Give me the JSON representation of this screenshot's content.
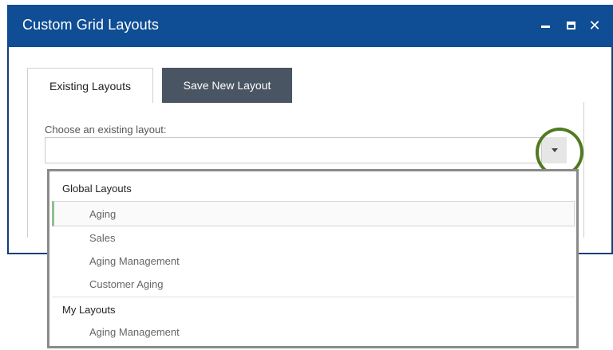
{
  "window": {
    "title": "Custom Grid Layouts",
    "controls": {
      "minimize": "–",
      "maximize": "□",
      "close": "✕"
    }
  },
  "tabs": [
    {
      "label": "Existing Layouts",
      "active": true
    },
    {
      "label": "Save New Layout",
      "active": false
    }
  ],
  "form": {
    "label": "Choose an existing layout:",
    "value": ""
  },
  "dropdown": {
    "groups": [
      {
        "label": "Global Layouts",
        "items": [
          "Aging",
          "Sales",
          "Aging Management",
          "Customer Aging"
        ]
      },
      {
        "label": "My Layouts",
        "items": [
          "Aging Management"
        ]
      }
    ],
    "highlighted": "Aging"
  },
  "colors": {
    "titlebar": "#0f4d94",
    "inactive_tab": "#4a5563",
    "highlight_ring": "#4f7a1f"
  }
}
